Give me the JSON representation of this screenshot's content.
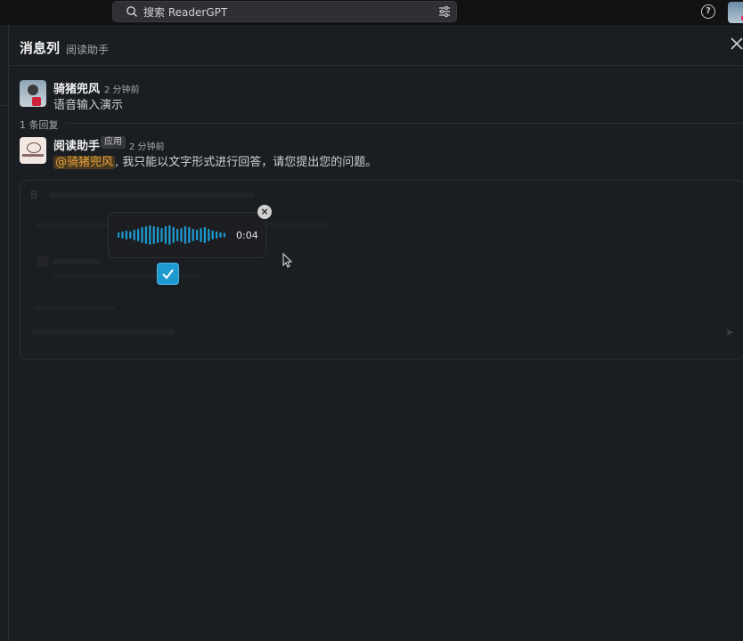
{
  "topbar": {
    "search_placeholder": "搜索 ReaderGPT",
    "icons": [
      "search-icon",
      "filter-icon",
      "help-icon",
      "user-avatar"
    ]
  },
  "header": {
    "title": "消息列",
    "subtitle": "阅读助手"
  },
  "messages": [
    {
      "author": "骑猪兜风",
      "time": "2 分钟前",
      "text": "语音输入演示"
    },
    {
      "author": "阅读助手",
      "tag": "应用",
      "time": "2 分钟前",
      "mention": "@骑猪兜风",
      "text": ", 我只能以文字形式进行回答，请您提出您的问题。"
    }
  ],
  "thread": {
    "replies_label": "1 条回复"
  },
  "voice_recorder": {
    "duration": "0:04",
    "waveform_color": "#1d9bd1"
  },
  "colors": {
    "accent": "#1d9bd1",
    "background": "#1a1d21",
    "mention_text": "#e8a33b"
  }
}
